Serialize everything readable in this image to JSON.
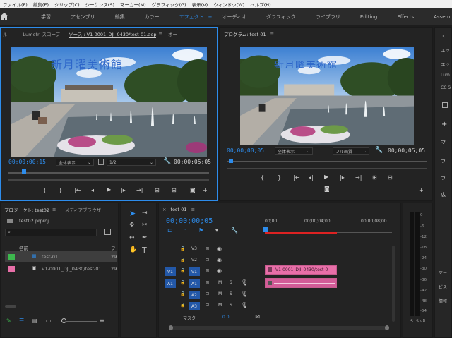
{
  "menubar": {
    "items": [
      "ファイル(F)",
      "編集(E)",
      "クリップ(C)",
      "シーケンス(S)",
      "マーカー(M)",
      "グラフィック(G)",
      "表示(V)",
      "ウィンドウ(W)",
      "ヘルプ(H)"
    ]
  },
  "workspaces": {
    "items": [
      "学習",
      "アセンブリ",
      "編集",
      "カラー",
      "エフェクト",
      "オーディオ",
      "グラフィック",
      "ライブラリ",
      "Editing",
      "Effects",
      "Assembly"
    ],
    "active": "エフェクト",
    "accent": "#2d8ceb"
  },
  "source_panel": {
    "tab_left": "ル",
    "tab_lumetri": "Lumetri スコープ",
    "tab_source": "ソース : V1-0001_DJI_0430/test-01.aep",
    "tab_more": "オー",
    "overlay_text": "新月曜美術館",
    "timecode_in": "00;00;00;15",
    "zoom": "全体表示",
    "resolution": "1/2",
    "timecode_dur": "00;00;05;05"
  },
  "program_panel": {
    "title": "プログラム: test-01",
    "overlay_text": "新月曜美術館",
    "timecode_in": "00;00;00;05",
    "zoom": "全体表示",
    "resolution": "フル画質",
    "timecode_dur": "00;00;05;05"
  },
  "right_panel": {
    "tabs": [
      "エ",
      "エッ",
      "エッ",
      "Lum",
      "CC S"
    ],
    "items": [
      "マ",
      "ラ",
      "ラ",
      "広"
    ],
    "bottom": [
      "マー",
      "ビス",
      "情報"
    ]
  },
  "project_panel": {
    "tab_project": "プロジェクト: test02",
    "tab_media": "メディアブラウザ",
    "filename": "test02.prproj",
    "col_name": "名前",
    "col_frame": "フ",
    "items": [
      {
        "name": "test-01",
        "color": "#3db84e",
        "rate": "29"
      },
      {
        "name": "V1-0001_DJI_0430/test-01.",
        "color": "#e86fa8",
        "rate": "29"
      }
    ]
  },
  "timeline": {
    "tab": "test-01",
    "timecode": "00;00;00;05",
    "ruler": [
      "00;00",
      "00;00;04;00",
      "00;00;08;00"
    ],
    "tracks": [
      {
        "label": "V3",
        "type": "video"
      },
      {
        "label": "V2",
        "type": "video"
      },
      {
        "label": "V1",
        "type": "video",
        "src": "V1"
      },
      {
        "label": "A1",
        "type": "audio",
        "src": "A1"
      },
      {
        "label": "A2",
        "type": "audio"
      },
      {
        "label": "A3",
        "type": "audio"
      }
    ],
    "clip_label": "V1-0001_DJI_0430/test-0",
    "master_label": "マスター",
    "master_value": "0.0",
    "m_label": "M",
    "s_label": "S"
  },
  "meters": {
    "ticks": [
      "0",
      "-6",
      "-12",
      "-18",
      "-24",
      "-30",
      "-36",
      "-42",
      "-48",
      "-54",
      "dB"
    ],
    "solo": [
      "S",
      "S"
    ]
  }
}
